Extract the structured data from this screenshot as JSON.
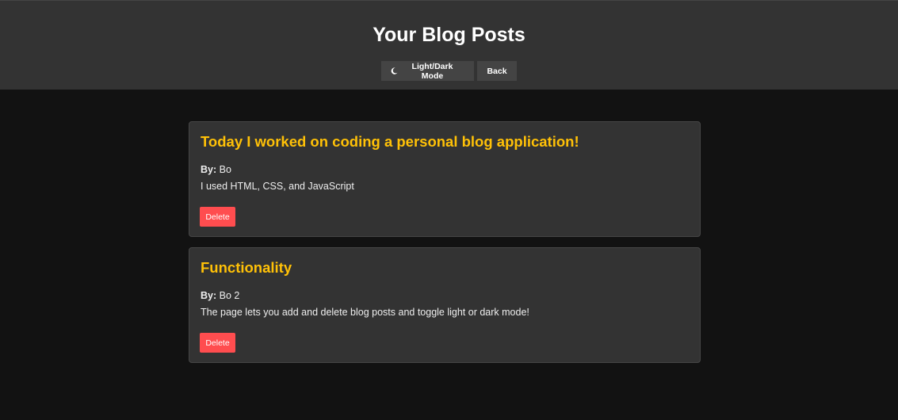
{
  "header": {
    "title": "Your Blog Posts",
    "theme_button_label": "Light/Dark Mode",
    "back_button_label": "Back"
  },
  "posts": [
    {
      "title": "Today I worked on coding a personal blog application!",
      "by_label": "By:",
      "author": "Bo",
      "body": "I used HTML, CSS, and JavaScript",
      "delete_label": "Delete"
    },
    {
      "title": "Functionality",
      "by_label": "By:",
      "author": "Bo 2",
      "body": "The page lets you add and delete blog posts and toggle light or dark mode!",
      "delete_label": "Delete"
    }
  ],
  "icons": {
    "theme_toggle": "moon-icon"
  },
  "colors": {
    "page_background": "#121212",
    "header_background": "#333333",
    "card_background": "#333333",
    "post_title": "#ffc107",
    "delete_button": "#ff4d4f"
  }
}
